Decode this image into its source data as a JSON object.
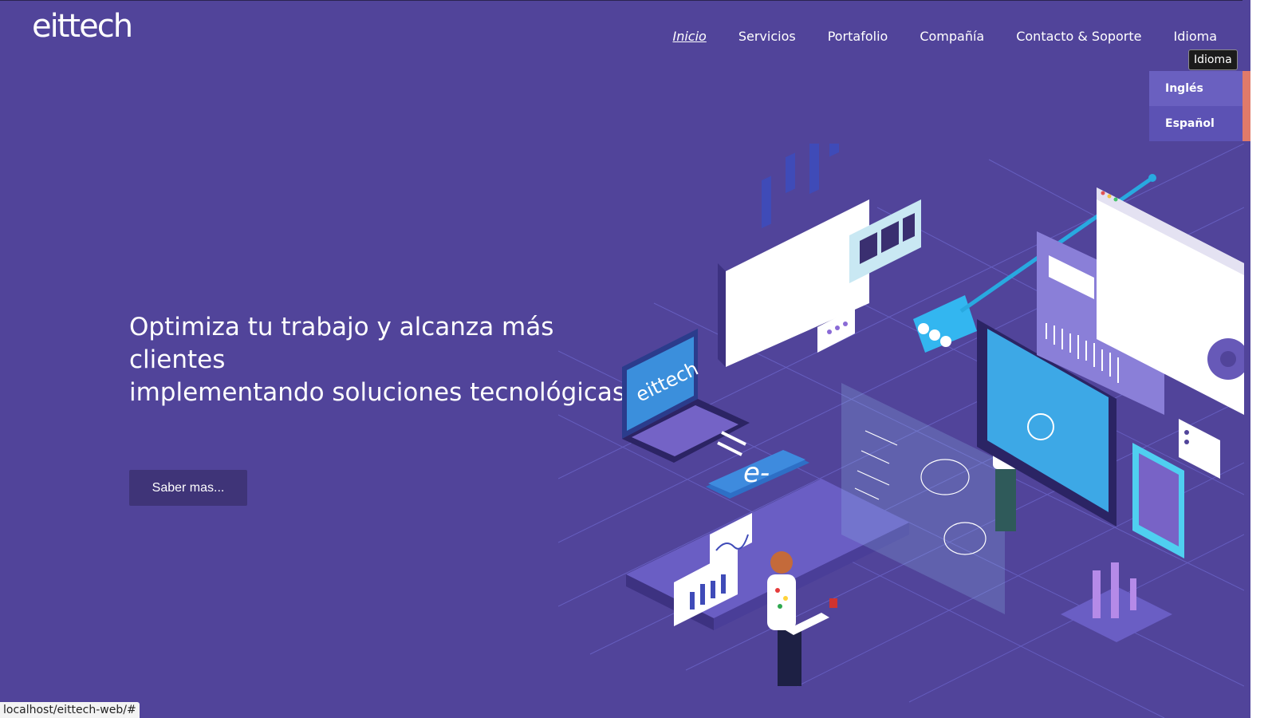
{
  "header": {
    "logo_text": "eittech"
  },
  "nav": {
    "items": [
      {
        "label": "Inicio",
        "active": true
      },
      {
        "label": "Servicios"
      },
      {
        "label": "Portafolio"
      },
      {
        "label": "Compañía"
      },
      {
        "label": "Contacto & Soporte"
      },
      {
        "label": "Idioma"
      }
    ],
    "tooltip": "Idioma"
  },
  "language_menu": {
    "items": [
      "Inglés",
      "Español"
    ]
  },
  "hero": {
    "headline_line1": "Optimiza tu trabajo y alcanza más clientes",
    "headline_line2": "implementando soluciones tecnológicas.",
    "cta_label": "Saber mas..."
  },
  "illustration": {
    "laptop_logo": "eittech",
    "phone_text": "e-"
  },
  "status": {
    "url": "localhost/eittech-web/#"
  },
  "colors": {
    "background": "#51449a",
    "button": "#3f3478",
    "menu": "#5c52b4",
    "accent": "#28a9e0"
  }
}
